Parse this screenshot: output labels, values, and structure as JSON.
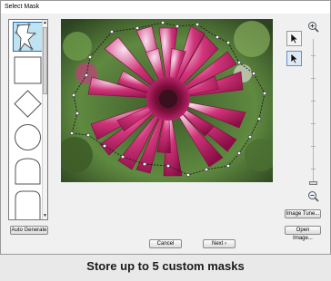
{
  "window": {
    "title": "Select Mask"
  },
  "shapes_panel": {
    "items": [
      {
        "name": "custom-star-mask",
        "selected": true
      },
      {
        "name": "square-mask",
        "selected": false
      },
      {
        "name": "diamond-mask",
        "selected": false
      },
      {
        "name": "circle-mask",
        "selected": false
      },
      {
        "name": "arch-mask",
        "selected": false
      },
      {
        "name": "rounded-arch-mask",
        "selected": false
      }
    ]
  },
  "toolbar": {
    "pointer_tool": "arrow-icon",
    "node_tool": "node-arrow-icon",
    "zoom_in_icon": "zoom-in-icon",
    "zoom_out_icon": "zoom-out-icon"
  },
  "buttons": {
    "auto_generate": "Auto Generate",
    "cancel": "Cancel",
    "next": "Next ›",
    "image_tune": "Image Tune...",
    "open_image": "Open Image..."
  },
  "caption": "Store up to 5 custom masks",
  "colors": {
    "selection_highlight": "#bfe3f2",
    "flower_main": "#b0155a",
    "flower_tip": "#f4d6e6",
    "foliage": "#4d7a35"
  }
}
